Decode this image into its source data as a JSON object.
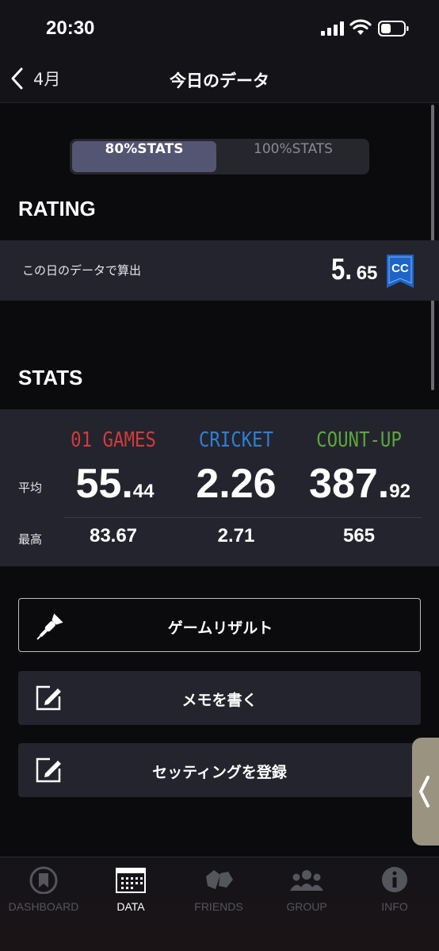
{
  "status_bar": {
    "time": "20:30"
  },
  "nav": {
    "back_label": "4月",
    "title": "今日のデータ"
  },
  "segmented": {
    "option_1": "80%STATS",
    "option_2": "100%STATS",
    "selected": "80%STATS"
  },
  "rating": {
    "section_title": "RATING",
    "row_label": "この日のデータで算出",
    "value_int": "5.",
    "value_dec": "65",
    "badge": "CC",
    "badge_color": "#1e64c8"
  },
  "stats": {
    "section_title": "STATS",
    "avg_label": "平均",
    "max_label": "最高",
    "columns": [
      {
        "title": "01 GAMES",
        "color": "#d23b3b",
        "avg_int": "55.",
        "avg_dec": "44",
        "max": "83.67"
      },
      {
        "title": "CRICKET",
        "color": "#2e7fd6",
        "avg_int": "2.26",
        "avg_dec": "",
        "max": "2.71"
      },
      {
        "title": "COUNT-UP",
        "color": "#5aa83a",
        "avg_int": "387.",
        "avg_dec": "92",
        "max": "565"
      }
    ]
  },
  "buttons": {
    "game_result": "ゲームリザルト",
    "write_memo": "メモを書く",
    "register_setting": "セッティングを登録"
  },
  "tabbar": {
    "items": [
      {
        "label": "DASHBOARD",
        "icon": "dashboard-icon",
        "active": false
      },
      {
        "label": "DATA",
        "icon": "calendar-icon",
        "active": true
      },
      {
        "label": "FRIENDS",
        "icon": "friends-icon",
        "active": false
      },
      {
        "label": "GROUP",
        "icon": "group-icon",
        "active": false
      },
      {
        "label": "INFO",
        "icon": "info-icon",
        "active": false
      }
    ]
  }
}
